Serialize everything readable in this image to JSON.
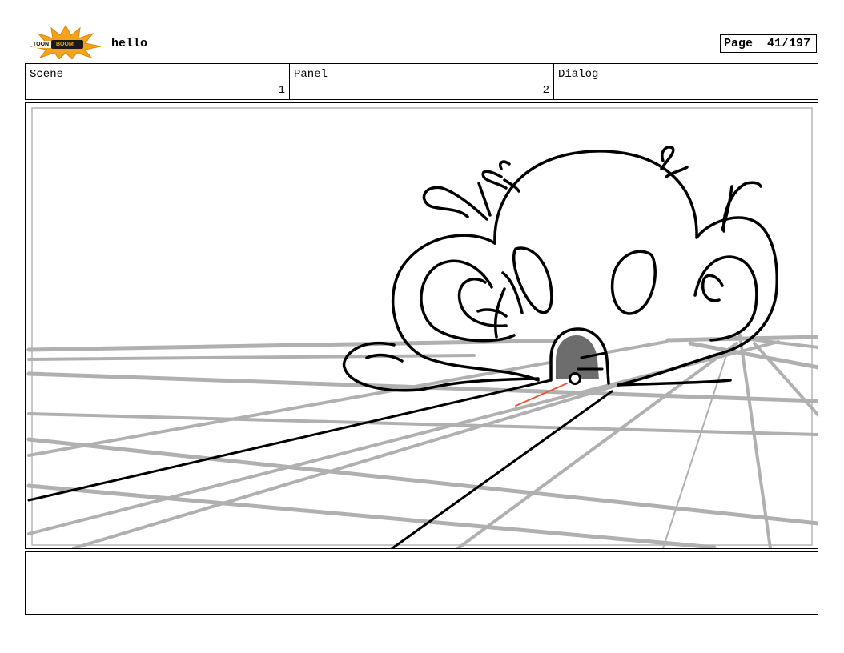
{
  "header": {
    "logo_text_left": "TOON",
    "logo_text_right": "BOOM",
    "project_title": "hello",
    "page_label": "Page",
    "page_number": "41/197"
  },
  "info": {
    "scene_label": "Scene",
    "scene_value": "1",
    "panel_label": "Panel",
    "panel_value": "2",
    "dialog_label": "Dialog",
    "dialog_value": ""
  },
  "panel": {
    "image": "octopus-sketch-on-perspective-grid",
    "colors": {
      "grid": "#b0b0b0",
      "ink": "#000000",
      "arrow": "#e8563a",
      "shade": "#6d6d6d"
    }
  },
  "notes": {
    "text": ""
  },
  "logo": {
    "burst_color": "#f5a31a"
  }
}
